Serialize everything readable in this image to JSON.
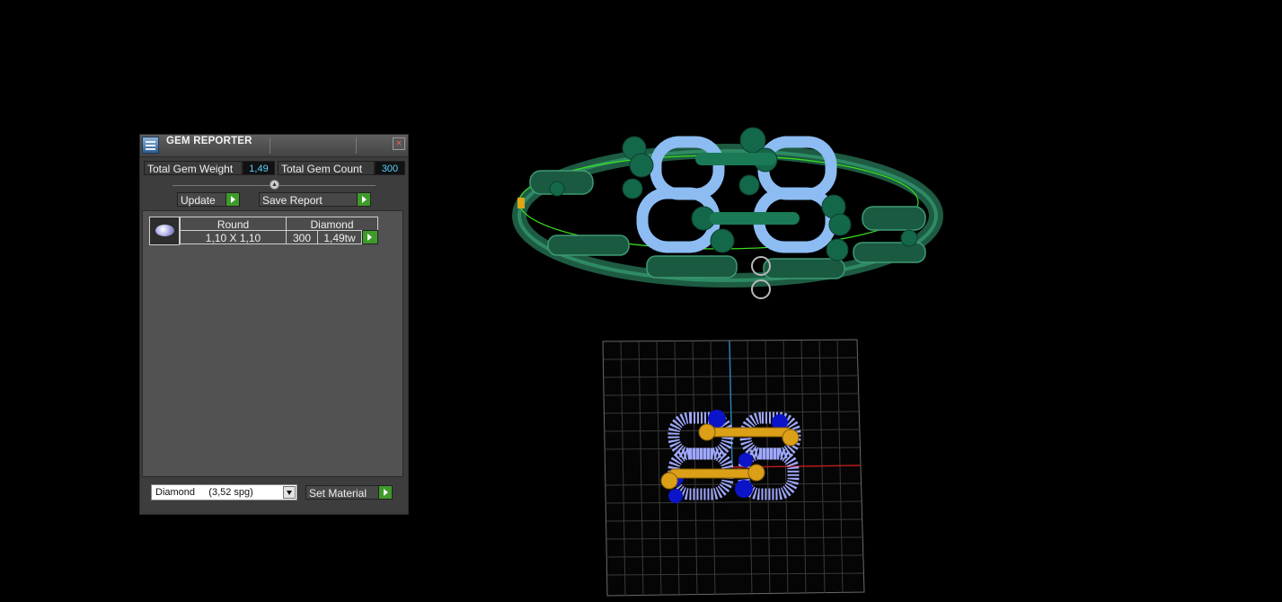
{
  "panel": {
    "title": "GEM REPORTER",
    "close_glyph": "×",
    "total_gem_weight_label": "Total Gem Weight",
    "total_gem_weight_value": "1,49",
    "total_gem_count_label": "Total Gem Count",
    "total_gem_count_value": "300",
    "update_label": "Update",
    "save_report_label": "Save Report",
    "gem_rows": [
      {
        "shape": "Round",
        "material": "Diamond",
        "size": "1,10 X 1,10",
        "count": "300",
        "weight": "1,49tw"
      }
    ],
    "material_select_value": "Diamond     (3,52 spg)",
    "set_material_label": "Set Material"
  },
  "icons": {
    "title": "gem-reporter-app-icon",
    "close": "close-icon",
    "gem": "round-gem-icon",
    "play": "play-arrow-icon",
    "dropdown": "chevron-down-icon"
  },
  "colors": {
    "accent_value": "#5ad2ff",
    "play_button": "#3e9b2a",
    "metal_green": "#1e6a4a",
    "gem_blue": "#8ab8f0",
    "gold": "#d8a020"
  }
}
